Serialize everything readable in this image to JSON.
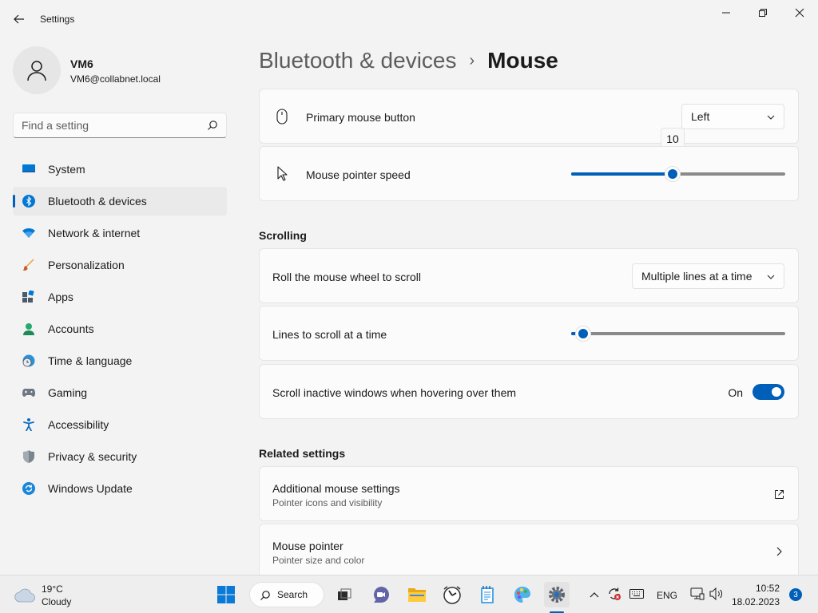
{
  "window": {
    "title": "Settings",
    "minimize_glyph": "—",
    "maximize_glyph": "❐",
    "close_glyph": "✕"
  },
  "profile": {
    "name": "VM6",
    "email": "VM6@collabnet.local"
  },
  "search": {
    "placeholder": "Find a setting"
  },
  "sidebar": {
    "items": [
      {
        "label": "System",
        "icon": "system-icon"
      },
      {
        "label": "Bluetooth & devices",
        "icon": "bluetooth-icon",
        "active": true
      },
      {
        "label": "Network & internet",
        "icon": "wifi-icon"
      },
      {
        "label": "Personalization",
        "icon": "brush-icon"
      },
      {
        "label": "Apps",
        "icon": "apps-icon"
      },
      {
        "label": "Accounts",
        "icon": "accounts-icon"
      },
      {
        "label": "Time & language",
        "icon": "clock-globe-icon"
      },
      {
        "label": "Gaming",
        "icon": "gamepad-icon"
      },
      {
        "label": "Accessibility",
        "icon": "accessibility-icon"
      },
      {
        "label": "Privacy & security",
        "icon": "shield-icon"
      },
      {
        "label": "Windows Update",
        "icon": "update-icon"
      }
    ]
  },
  "breadcrumb": {
    "parent": "Bluetooth & devices",
    "separator": "›",
    "current": "Mouse"
  },
  "mouse": {
    "primary_button": {
      "label": "Primary mouse button",
      "value": "Left"
    },
    "pointer_speed": {
      "label": "Mouse pointer speed",
      "value": 10,
      "value_text": "10",
      "min": 1,
      "max": 20
    }
  },
  "scrolling": {
    "title": "Scrolling",
    "roll_wheel": {
      "label": "Roll the mouse wheel to scroll",
      "value": "Multiple lines at a time"
    },
    "lines": {
      "label": "Lines to scroll at a time",
      "value": 3,
      "min": 1,
      "max": 100
    },
    "inactive": {
      "label": "Scroll inactive windows when hovering over them",
      "state": "On"
    }
  },
  "related": {
    "title": "Related settings",
    "additional": {
      "label": "Additional mouse settings",
      "sub": "Pointer icons and visibility"
    },
    "pointer": {
      "label": "Mouse pointer",
      "sub": "Pointer size and color"
    }
  },
  "taskbar": {
    "weather_temp": "19°C",
    "weather_cond": "Cloudy",
    "search_label": "Search",
    "language": "ENG",
    "time": "10:52",
    "date": "18.02.2023",
    "notifications": "3"
  },
  "colors": {
    "accent": "#005fb8",
    "background": "#f3f3f3",
    "card": "#fbfbfb"
  }
}
